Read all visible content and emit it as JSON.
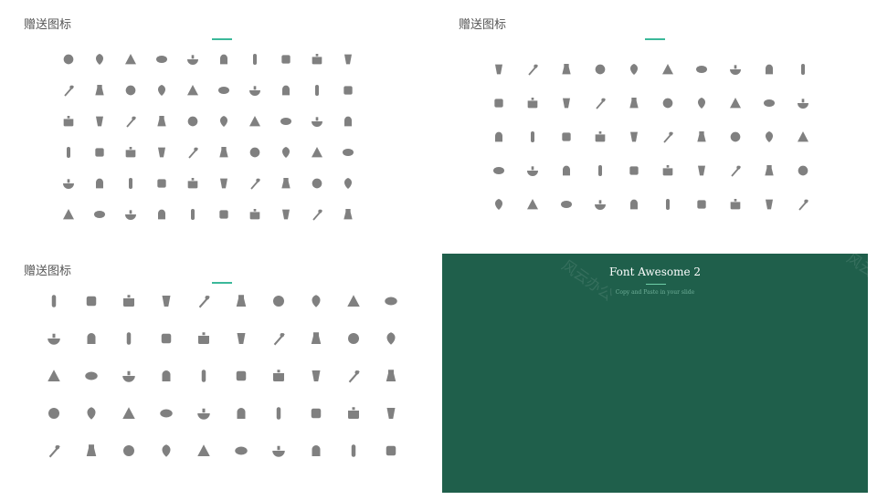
{
  "colors": {
    "accent": "#3bb89a",
    "icon": "#808080",
    "dark_panel": "#1f5f4b",
    "title_text": "#555555"
  },
  "panels": [
    {
      "title": "赠送图标",
      "grid": "g1",
      "columns": 10,
      "icons": [
        "cloche",
        "coffee-cup",
        "plate-setting",
        "cocktail",
        "smoothie",
        "teacup",
        "roast-chicken",
        "wine-bottle",
        "pot",
        "wine-glasses",
        "drumstick",
        "bread",
        "grill",
        "cake",
        "candy",
        "kettle",
        "apple",
        "microwave",
        "spatula",
        "plate",
        "cutlery",
        "chef-hat",
        "cake-slice",
        "burger",
        "carrot",
        "steak",
        "martini",
        "cooking-pot",
        "chef-hat-2",
        "pepper",
        "ice-cream",
        "toaster",
        "bottle",
        "bowl",
        "barbecue",
        "corn",
        "cup",
        "grapes",
        "broccoli",
        "soup",
        "baguette",
        "cake-tiers",
        "coffee-mug",
        "pizza",
        "bell-pepper",
        "fish",
        "serving",
        "waiter",
        "burger-2",
        "tomato",
        "mortar",
        "fast-food",
        "cheese",
        "birthday-cake",
        "wok",
        "soda-can",
        "takeaway-cup",
        "coffee-beans",
        "pie",
        "wheat"
      ]
    },
    {
      "title": "赠送图标",
      "grid": "g2",
      "columns": 10,
      "icons": [
        "taco",
        "watermelon",
        "cookie",
        "toast",
        "banana",
        "drumstick",
        "pineapple",
        "donut",
        "oven",
        "soup",
        "fridge",
        "cherries",
        "fruit-drink",
        "strawberry",
        "cutlery-cross",
        "sundae",
        "fruit-bowl",
        "bottle",
        "coffee-machine",
        "teapot",
        "barbecue",
        "cheese",
        "coffee-cup",
        "saucepan",
        "hot-soup",
        "pouring",
        "bowl",
        "fries",
        "noodles",
        "rice-bowl",
        "cocktail",
        "corkscrew",
        "tea-bag",
        "tea-tag",
        "coffee-mug",
        "ladle",
        "carrot",
        "chef-hat",
        "bone",
        "corn",
        "whisk",
        "mixing-bowl",
        "jug",
        "lemon",
        "fast-food",
        "blender",
        "cheese-wedge",
        "grill",
        "beer",
        "milkshake"
      ]
    },
    {
      "title": "赠送图标",
      "grid": "g3",
      "columns": 10,
      "icons": [
        "chopsticks",
        "muffin",
        "jar",
        "peas",
        "cake-slice",
        "sausage",
        "eggplant",
        "wine-glass",
        "fish-bone",
        "fries-bag",
        "cupcake",
        "banana",
        "scale",
        "salt-shaker",
        "hot-dog",
        "bread-loaf",
        "lemon",
        "pear",
        "turkey",
        "popsicle",
        "candy",
        "cupcake-2",
        "ham",
        "fried-egg",
        "pretzel",
        "egg-cup",
        "noodle-bowl",
        "teapot",
        "burger",
        "bean-pod",
        "croissant",
        "kebab",
        "lollipop",
        "oven-mitt",
        "steak",
        "chicken",
        "ham-leg",
        "plate",
        "flower",
        "beet",
        "cauldron",
        "coffee-cup",
        "bacon",
        "pumpkin",
        "flour-bag",
        "cupcake-3",
        "pumpkin-2",
        "sundae",
        "grapes",
        "tulip"
      ]
    }
  ],
  "dark_panel": {
    "title": "Font Awesome 2",
    "subtitle": "Copy and Paste in your slide",
    "watermark": "风云办公"
  }
}
